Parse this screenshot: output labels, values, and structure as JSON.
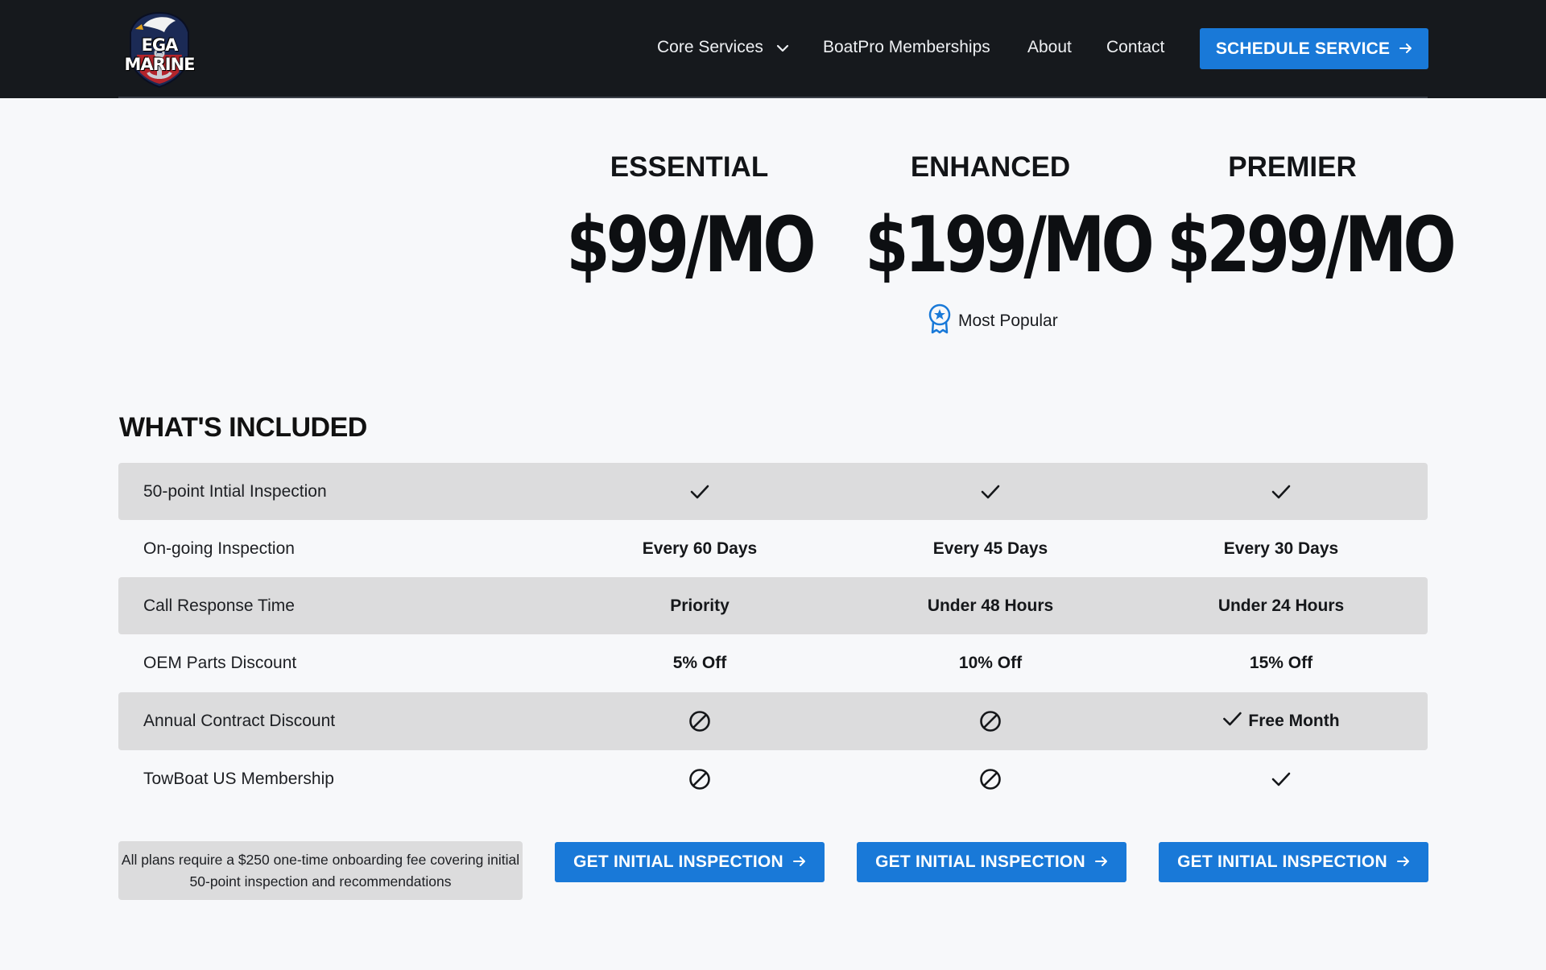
{
  "brand": {
    "logo_text": "EGA MARINE"
  },
  "nav": {
    "items": [
      {
        "label": "Core Services"
      },
      {
        "label": "BoatPro Memberships"
      },
      {
        "label": "About"
      },
      {
        "label": "Contact"
      }
    ],
    "cta_label": "SCHEDULE SERVICE"
  },
  "plans": [
    {
      "name": "ESSENTIAL",
      "price": "$99/MO"
    },
    {
      "name": "ENHANCED",
      "price": "$199/MO"
    },
    {
      "name": "PREMIER",
      "price": "$299/MO"
    }
  ],
  "popular_label": "Most Popular",
  "section_title": "WHAT'S INCLUDED",
  "rows": [
    {
      "label": "50-point Intial Inspection",
      "values": [
        "check",
        "check",
        "check"
      ]
    },
    {
      "label": "On-going Inspection",
      "values": [
        "Every 60 Days",
        "Every 45 Days",
        "Every 30 Days"
      ]
    },
    {
      "label": "Call Response Time",
      "values": [
        "Priority",
        "Under 48 Hours",
        "Under 24 Hours"
      ]
    },
    {
      "label": "OEM Parts Discount",
      "values": [
        "5% Off",
        "10% Off",
        "15% Off"
      ]
    },
    {
      "label": "Annual Contract Discount",
      "values": [
        "none",
        "none",
        "Free Month"
      ]
    },
    {
      "label": "TowBoat US Membership",
      "values": [
        "none",
        "none",
        "check"
      ]
    }
  ],
  "fee_note": "All plans require a $250 one-time onboarding fee covering initial 50-point inspection and recommendations",
  "cta_label": "GET INITIAL INSPECTION",
  "colors": {
    "accent": "#1979d8",
    "header_bg": "#16191d",
    "row_shade": "#dcdcdd"
  }
}
